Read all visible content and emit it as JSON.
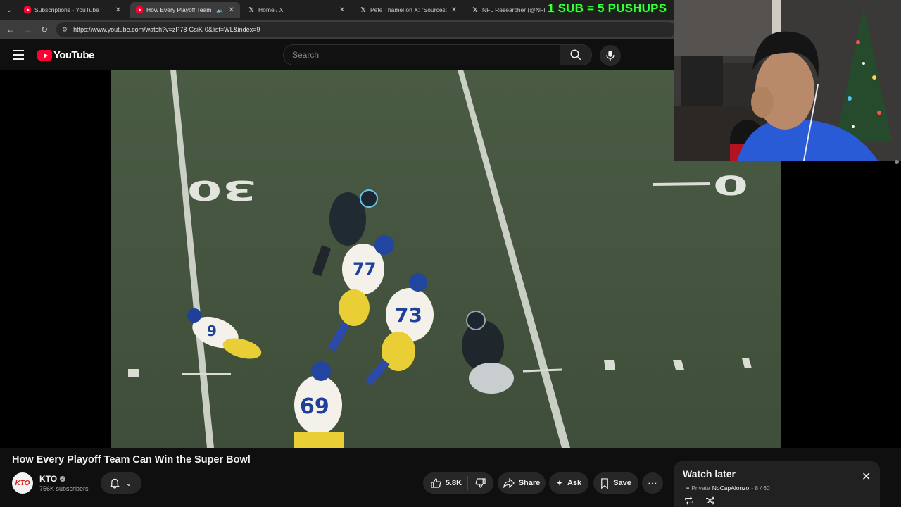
{
  "browser": {
    "tabs": [
      {
        "title": "Subscriptions - YouTube",
        "icon": "youtube-favicon",
        "active": false
      },
      {
        "title": "How Every Playoff Team Ca",
        "icon": "youtube-favicon",
        "active": true
      },
      {
        "title": "Home / X",
        "icon": "x-favicon",
        "active": false
      },
      {
        "title": "Pete Thamel on X: \"Sources: Oh",
        "icon": "x-favicon",
        "active": false
      },
      {
        "title": "NFL Researcher (@NFL_Rese",
        "icon": "x-favicon",
        "active": false
      }
    ],
    "url": "https://www.youtube.com/watch?v=zP78-GsiK-0&list=WL&index=9"
  },
  "overlay": {
    "banner_text": "1 SUB = 5 PUSHUPS"
  },
  "youtube": {
    "logo_text": "YouTube",
    "search_placeholder": "Search"
  },
  "video": {
    "yard_left": "30",
    "yard_right": "0",
    "jersey_numbers": [
      "9",
      "77",
      "73",
      "69"
    ]
  },
  "details": {
    "title": "How Every Playoff Team Can Win the Super Bowl",
    "channel_name": "KTO",
    "channel_avatar_text": "KTO",
    "subscribers": "756K subscribers",
    "likes": "5.8K",
    "share_label": "Share",
    "ask_label": "Ask",
    "save_label": "Save"
  },
  "playlist": {
    "title": "Watch later",
    "privacy": "Private",
    "owner": "NoCapAlonzo",
    "position": "- 8 / 60"
  }
}
